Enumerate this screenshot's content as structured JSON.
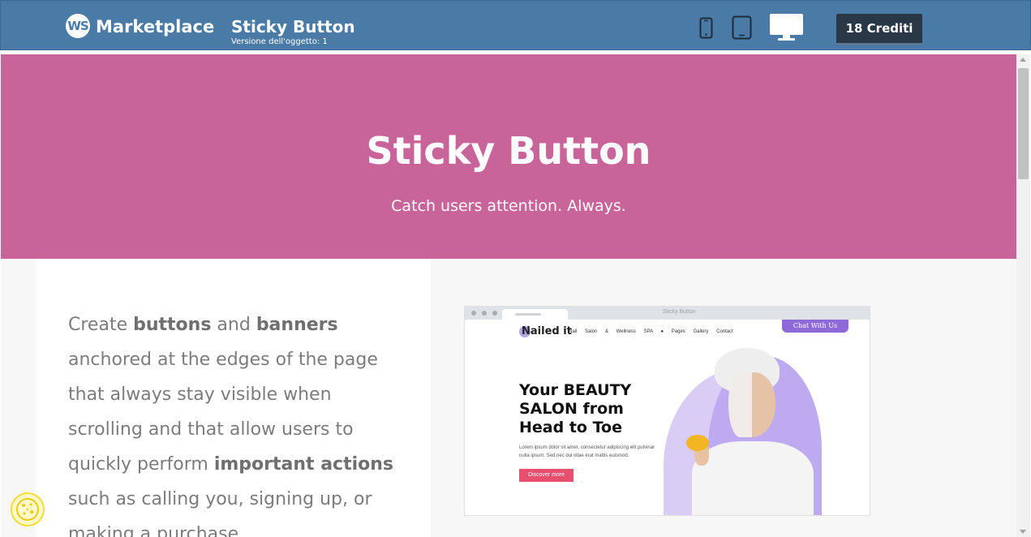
{
  "header": {
    "logo_text": "WS",
    "brand": "Marketplace",
    "title": "Sticky Button",
    "version": "Versione dell'oggetto: 1",
    "devices": [
      "phone-icon",
      "tablet-icon",
      "desktop-icon"
    ],
    "active_device": "desktop",
    "credits_label": "18 Crediti"
  },
  "hero": {
    "title": "Sticky Button",
    "subtitle": "Catch users attention. Always.",
    "background": "#c9649a"
  },
  "description": {
    "parts": [
      {
        "text": "Create ",
        "bold": false
      },
      {
        "text": "buttons",
        "bold": true
      },
      {
        "text": " and ",
        "bold": false
      },
      {
        "text": "banners",
        "bold": true
      },
      {
        "text": " anchored at the edges of the page that always stay visible when scrolling and that allow users to quickly perform ",
        "bold": false
      },
      {
        "text": "important actions",
        "bold": true
      },
      {
        "text": " such as calling you, signing up, or making a purchase.",
        "bold": false
      }
    ]
  },
  "preview": {
    "tab_title": "Sticky Button",
    "logo": "Nailed it",
    "nav": "Nail Salon & Wellness SPA ● Pages Gallery Contact",
    "chat_button": "Chat With Us",
    "headline": "Your BEAUTY SALON from Head to Toe",
    "lorem": "Lorem ipsum dolor sit amet, consectetur adipiscing elit pulvinar nulla ipsum. Sed nec dui vitae erat mattis euismod.",
    "cta": "Discover more"
  },
  "colors": {
    "topbar": "#4a7ba7",
    "credits_bg": "#293746",
    "chat_purple": "#8e6ad8",
    "cta_red": "#e84f6f"
  }
}
